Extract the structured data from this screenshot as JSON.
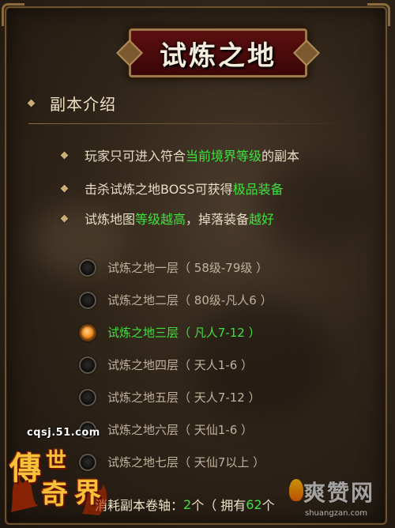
{
  "title": "试炼之地",
  "section": {
    "title": "副本介绍"
  },
  "bullets": [
    {
      "pre": "玩家只可进入符合",
      "hl": "当前境界等级",
      "post": "的副本"
    },
    {
      "pre": "击杀试炼之地BOSS可获得",
      "hl": "极品装备",
      "post": ""
    },
    {
      "pre": "试炼地图",
      "hl": "等级越高",
      "mid": "，掉落装备",
      "hl2": "越好"
    }
  ],
  "floors": [
    {
      "name": "试炼之地一层",
      "range": "（ 58级-79级 ）",
      "selected": false
    },
    {
      "name": "试炼之地二层",
      "range": "（ 80级-凡人6 ）",
      "selected": false
    },
    {
      "name": "试炼之地三层",
      "range": "（ 凡人7-12 ）",
      "selected": true
    },
    {
      "name": "试炼之地四层",
      "range": "（ 天人1-6 ）",
      "selected": false
    },
    {
      "name": "试炼之地五层",
      "range": "（ 天人7-12 ）",
      "selected": false
    },
    {
      "name": "试炼之地六层",
      "range": "（ 天仙1-6 ）",
      "selected": false
    },
    {
      "name": "试炼之地七层",
      "range": "（ 天仙7以上 ）",
      "selected": false
    }
  ],
  "footer": {
    "label": "消耗副本卷轴：",
    "cost": "2",
    "cost_unit": "个（ 拥有",
    "owned": "62",
    "owned_unit": "个"
  },
  "logo": {
    "url": "cqsj.51.com",
    "text": "傳世奇界"
  },
  "watermark": {
    "cn": "爽赞网",
    "url": "shuangzan.com"
  },
  "colors": {
    "highlight": "#3ee23e",
    "selected_radio": "#f08a1c",
    "title_plate": "#5c1010"
  }
}
